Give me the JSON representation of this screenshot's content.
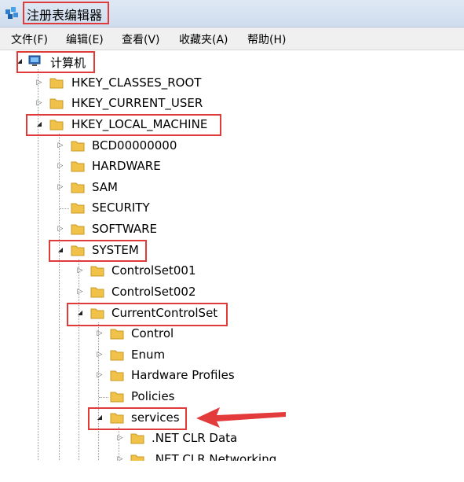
{
  "window": {
    "title": "注册表编辑器"
  },
  "menu": {
    "file": "文件(F)",
    "edit": "编辑(E)",
    "view": "查看(V)",
    "favorites": "收藏夹(A)",
    "help": "帮助(H)"
  },
  "tree": {
    "root": "计算机",
    "hkcr": "HKEY_CLASSES_ROOT",
    "hkcu": "HKEY_CURRENT_USER",
    "hklm": "HKEY_LOCAL_MACHINE",
    "bcd": "BCD00000000",
    "hardware": "HARDWARE",
    "sam": "SAM",
    "security": "SECURITY",
    "software": "SOFTWARE",
    "system": "SYSTEM",
    "cs001": "ControlSet001",
    "cs002": "ControlSet002",
    "ccs": "CurrentControlSet",
    "control": "Control",
    "enum": "Enum",
    "hwprofiles": "Hardware Profiles",
    "policies": "Policies",
    "services": "services",
    "netclrdata": ".NET CLR Data",
    "netclrnet": ".NET CLR Networking"
  },
  "colors": {
    "highlight": "#e03a3a",
    "folder": "#f1c24a"
  }
}
